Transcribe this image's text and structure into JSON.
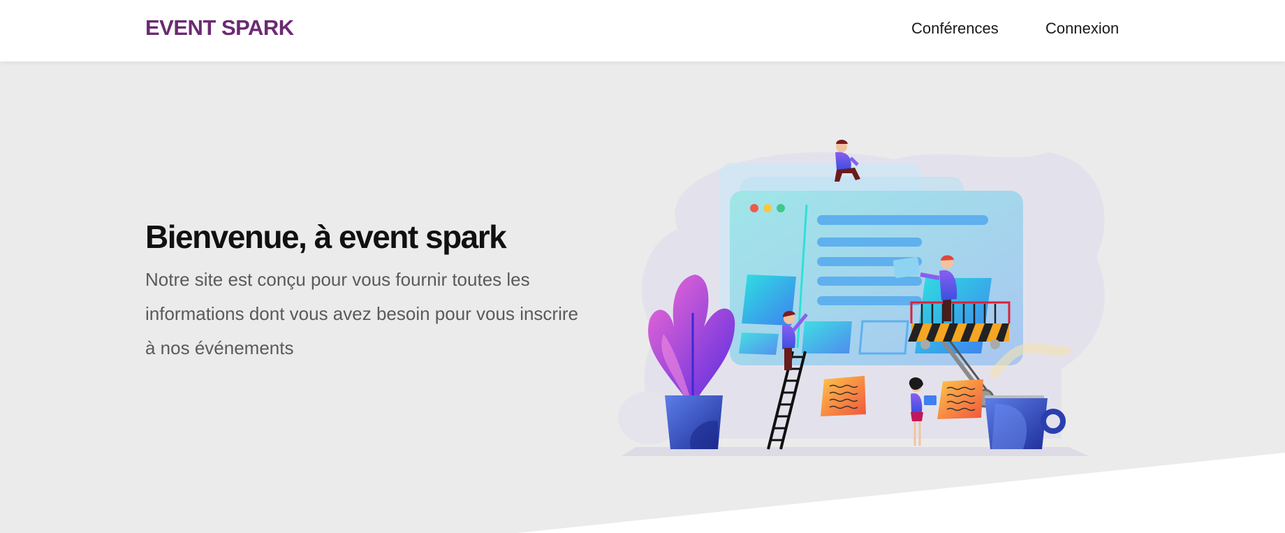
{
  "nav": {
    "brand": "EVENT SPARK",
    "links": [
      {
        "label": "Conférences"
      },
      {
        "label": "Connexion"
      }
    ]
  },
  "hero": {
    "title": "Bienvenue, à event spark",
    "text": "Notre site est conçu pour vous fournir toutes les informations dont vous avez besoin pour vous inscrire à nos événements",
    "illustration": "website-construction-illustration"
  },
  "colors": {
    "brand": "#6b2a73",
    "hero_bg": "#ebebeb",
    "title": "#111111",
    "text": "#5a5a5a"
  }
}
